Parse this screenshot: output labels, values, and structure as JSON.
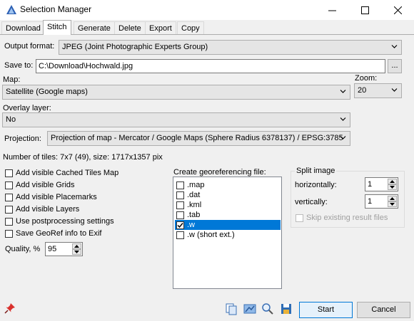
{
  "window": {
    "title": "Selection Manager",
    "minimize_glyph": "—",
    "maximize_glyph": "☐",
    "close_glyph": "✕"
  },
  "tabs": [
    {
      "label": "Download",
      "active": false
    },
    {
      "label": "Stitch",
      "active": true
    },
    {
      "label": "Generate",
      "active": false
    },
    {
      "label": "Delete",
      "active": false
    },
    {
      "label": "Export",
      "active": false
    },
    {
      "label": "Copy",
      "active": false
    }
  ],
  "stitch": {
    "output_format_label": "Output format:",
    "output_format_value": "JPEG (Joint Photographic Experts Group)",
    "save_to_label": "Save to:",
    "save_to_value": "C:\\Download\\Hochwald.jpg",
    "browse_label": "...",
    "map_label": "Map:",
    "map_value": "Satellite (Google maps)",
    "zoom_label": "Zoom:",
    "zoom_value": "20",
    "overlay_label": "Overlay layer:",
    "overlay_value": "No",
    "projection_label": "Projection:",
    "projection_value": "Projection of map - Mercator / Google Maps (Sphere Radius 6378137) / EPSG:3785",
    "tiles_info": "Number of tiles: 7x7 (49), size: 1717x1357 pix",
    "options": [
      {
        "label": "Add visible Cached Tiles Map",
        "checked": false
      },
      {
        "label": "Add visible Grids",
        "checked": false
      },
      {
        "label": "Add visible Placemarks",
        "checked": false
      },
      {
        "label": "Add visible Layers",
        "checked": false
      },
      {
        "label": "Use postprocessing settings",
        "checked": false
      },
      {
        "label": "Save GeoRef info to Exif",
        "checked": false
      }
    ],
    "quality_label": "Quality, %",
    "quality_value": "95",
    "georef_label": "Create georeferencing file:",
    "georef_items": [
      {
        "label": ".map",
        "checked": false,
        "selected": false
      },
      {
        "label": ".dat",
        "checked": false,
        "selected": false
      },
      {
        "label": ".kml",
        "checked": false,
        "selected": false
      },
      {
        "label": ".tab",
        "checked": false,
        "selected": false
      },
      {
        "label": ".w",
        "checked": true,
        "selected": true
      },
      {
        "label": ".w (short ext.)",
        "checked": false,
        "selected": false
      }
    ],
    "split_label": "Split image",
    "horizontally_label": "horizontally:",
    "horizontally_value": "1",
    "vertically_label": "vertically:",
    "vertically_value": "1",
    "skip_label": "Skip existing result files"
  },
  "footer": {
    "start_label": "Start",
    "cancel_label": "Cancel"
  },
  "colors": {
    "accent": "#0078d7",
    "selection": "#0078d7",
    "pin": "#d9302c"
  }
}
